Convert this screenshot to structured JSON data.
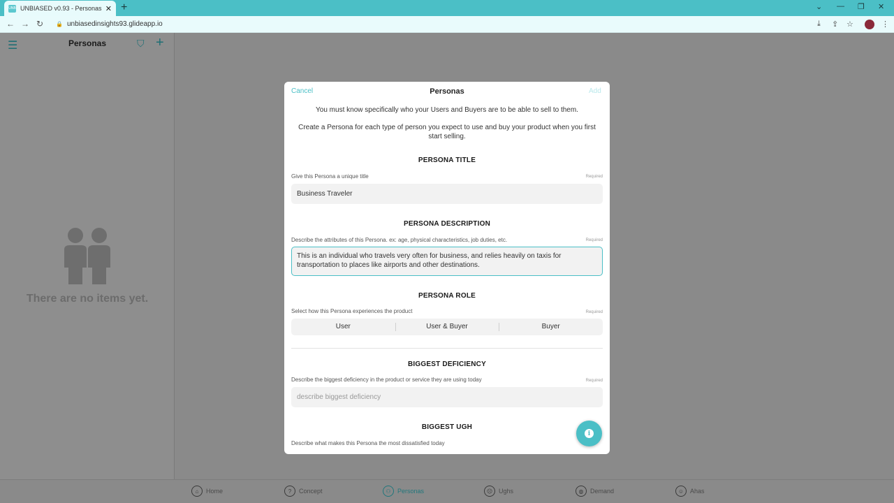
{
  "browser": {
    "tab_title": "UNBIASED v0.93 - Personas",
    "tab_favicon_text": "UNB",
    "url": "unbiasedinsights93.glideapp.io"
  },
  "sidebar": {
    "title": "Personas",
    "empty_text": "There are no items yet."
  },
  "bottom_nav": {
    "items": [
      {
        "label": "Home",
        "icon": "home-icon"
      },
      {
        "label": "Concept",
        "icon": "question-icon"
      },
      {
        "label": "Personas",
        "icon": "people-icon",
        "active": true
      },
      {
        "label": "Ughs",
        "icon": "frown-icon"
      },
      {
        "label": "Demand",
        "icon": "globe-icon"
      },
      {
        "label": "Ahas",
        "icon": "smile-icon"
      }
    ]
  },
  "modal": {
    "cancel": "Cancel",
    "title": "Personas",
    "add": "Add",
    "intro1": "You must know specifically who your Users and Buyers are to be able to sell to them.",
    "intro2": "Create a Persona for each type of person you expect to use and buy your product when you first start selling.",
    "required": "Required",
    "persona_title": {
      "heading": "PERSONA TITLE",
      "label": "Give this Persona a unique title",
      "value": "Business Traveler"
    },
    "persona_description": {
      "heading": "PERSONA DESCRIPTION",
      "label": "Describe the attributes of this Persona. ex: age, physical characteristics, job duties, etc.",
      "value": "This is an individual who travels very often for business, and relies heavily on taxis for transportation to places like airports and other destinations."
    },
    "persona_role": {
      "heading": "PERSONA ROLE",
      "label": "Select how this Persona experiences the product",
      "options": [
        "User",
        "User & Buyer",
        "Buyer"
      ]
    },
    "biggest_deficiency": {
      "heading": "BIGGEST DEFICIENCY",
      "label": "Describe the biggest deficiency in the product or service they are using today",
      "placeholder": "describe biggest deficiency"
    },
    "biggest_ugh": {
      "heading": "BIGGEST UGH",
      "label": "Describe what makes this Persona the most dissatisfied today"
    }
  },
  "colors": {
    "accent": "#4bbfc6",
    "overlay": "#8a8a8a"
  }
}
